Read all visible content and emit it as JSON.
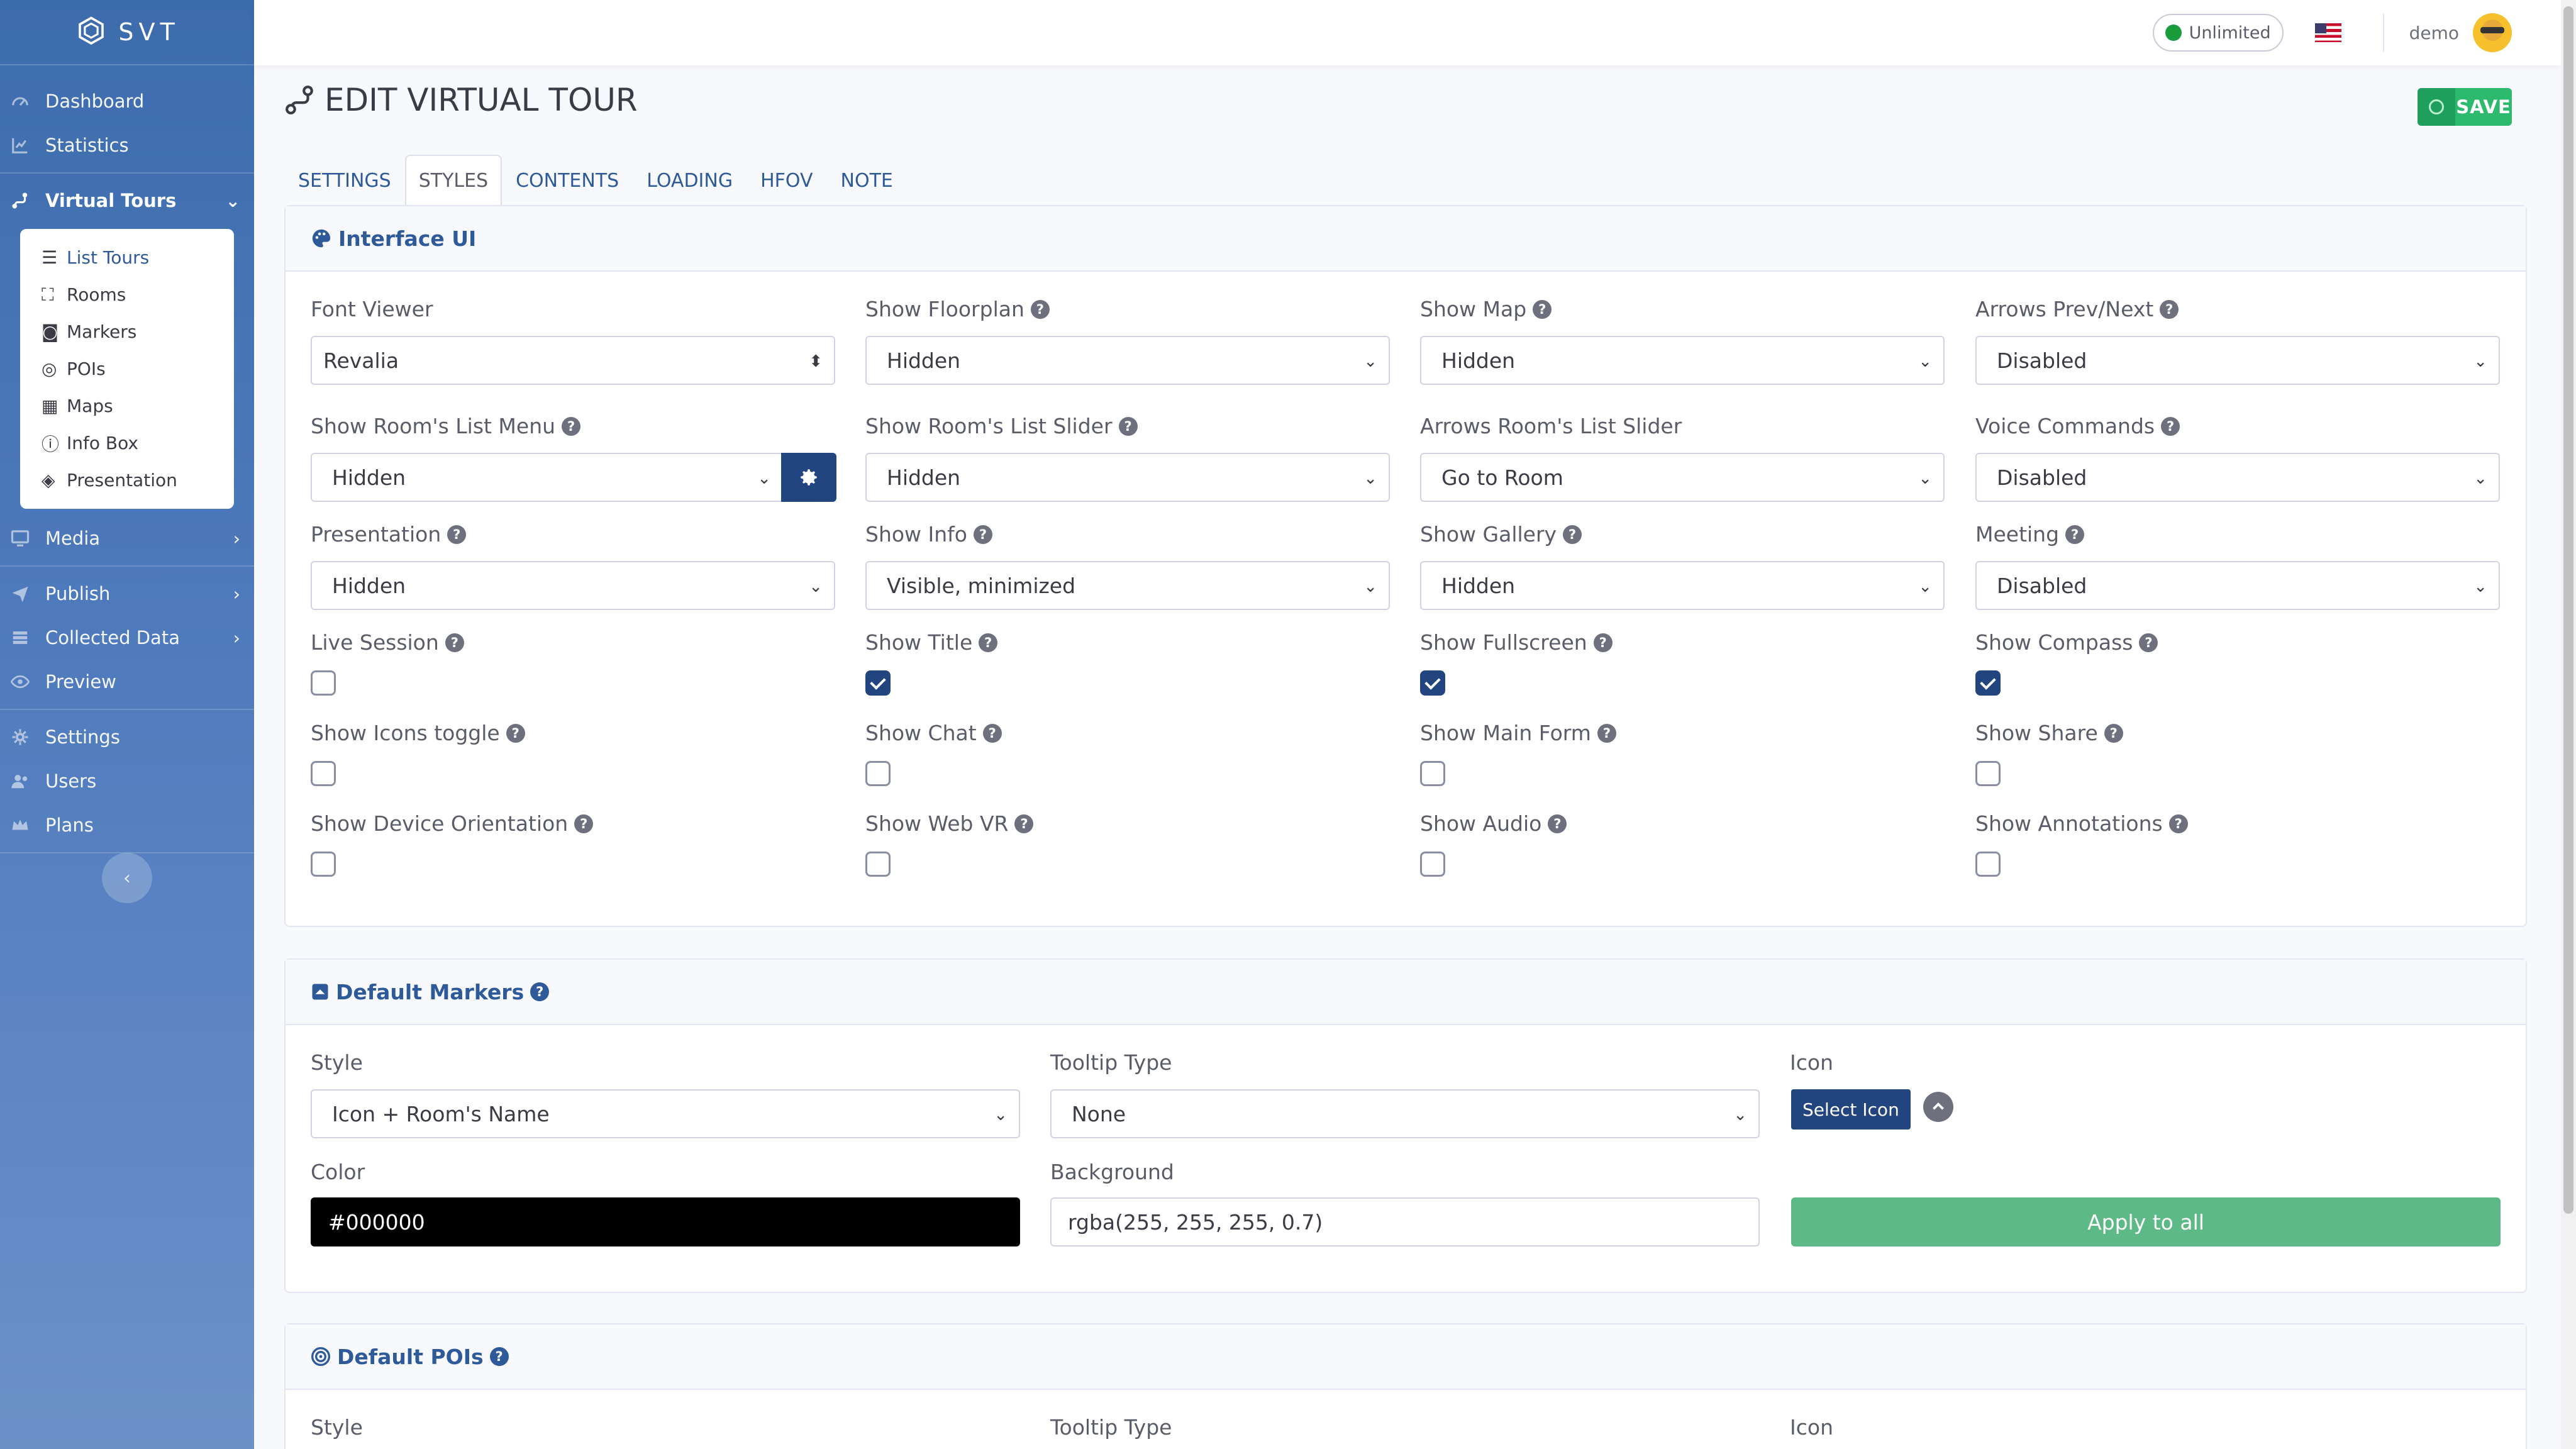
{
  "brand": {
    "name": "SVT"
  },
  "nav": {
    "dashboard": "Dashboard",
    "statistics": "Statistics",
    "virtual_tours": "Virtual Tours",
    "sub": [
      "List Tours",
      "Rooms",
      "Markers",
      "POIs",
      "Maps",
      "Info Box",
      "Presentation"
    ],
    "media": "Media",
    "publish": "Publish",
    "collected_data": "Collected Data",
    "preview": "Preview",
    "settings": "Settings",
    "users": "Users",
    "plans": "Plans"
  },
  "topbar": {
    "plan": "Unlimited",
    "username": "demo",
    "plan_status_color": "#1a9b3c"
  },
  "page": {
    "title": "EDIT VIRTUAL TOUR",
    "save_label": "SAVE"
  },
  "tabs": [
    "SETTINGS",
    "STYLES",
    "CONTENTS",
    "LOADING",
    "HFOV",
    "NOTE"
  ],
  "active_tab": "STYLES",
  "interface_ui": {
    "title": "Interface UI",
    "font_viewer": {
      "label": "Font Viewer",
      "value": "Revalia"
    },
    "show_floorplan": {
      "label": "Show Floorplan",
      "value": "Hidden"
    },
    "show_map": {
      "label": "Show Map",
      "value": "Hidden"
    },
    "arrows_prev_next": {
      "label": "Arrows Prev/Next",
      "value": "Disabled"
    },
    "show_rooms_list_menu": {
      "label": "Show Room's List Menu",
      "value": "Hidden"
    },
    "show_rooms_list_slider": {
      "label": "Show Room's List Slider",
      "value": "Hidden"
    },
    "arrows_rooms_list_slider": {
      "label": "Arrows Room's List Slider",
      "value": "Go to Room"
    },
    "voice_commands": {
      "label": "Voice Commands",
      "value": "Disabled"
    },
    "presentation": {
      "label": "Presentation",
      "value": "Hidden"
    },
    "show_info": {
      "label": "Show Info",
      "value": "Visible, minimized"
    },
    "show_gallery": {
      "label": "Show Gallery",
      "value": "Hidden"
    },
    "meeting": {
      "label": "Meeting",
      "value": "Disabled"
    },
    "checkboxes": [
      {
        "label": "Live Session",
        "checked": false
      },
      {
        "label": "Show Title",
        "checked": true
      },
      {
        "label": "Show Fullscreen",
        "checked": true
      },
      {
        "label": "Show Compass",
        "checked": true
      },
      {
        "label": "Show Icons toggle",
        "checked": false
      },
      {
        "label": "Show Chat",
        "checked": false
      },
      {
        "label": "Show Main Form",
        "checked": false
      },
      {
        "label": "Show Share",
        "checked": false
      },
      {
        "label": "Show Device Orientation",
        "checked": false
      },
      {
        "label": "Show Web VR",
        "checked": false
      },
      {
        "label": "Show Audio",
        "checked": false
      },
      {
        "label": "Show Annotations",
        "checked": false
      }
    ]
  },
  "default_markers": {
    "title": "Default Markers",
    "style": {
      "label": "Style",
      "value": "Icon + Room's Name"
    },
    "tooltip_type": {
      "label": "Tooltip Type",
      "value": "None"
    },
    "icon": {
      "label": "Icon",
      "button": "Select Icon"
    },
    "color": {
      "label": "Color",
      "value": "#000000"
    },
    "background": {
      "label": "Background",
      "value": "rgba(255, 255, 255, 0.7)"
    },
    "apply_label": "Apply to all"
  },
  "default_pois": {
    "title": "Default POIs",
    "style_label": "Style",
    "tooltip_label": "Tooltip Type",
    "icon_label": "Icon"
  },
  "colors": {
    "primary": "#22457f",
    "link": "#2e5a99",
    "save": "#2db96e",
    "apply": "#5db985"
  }
}
